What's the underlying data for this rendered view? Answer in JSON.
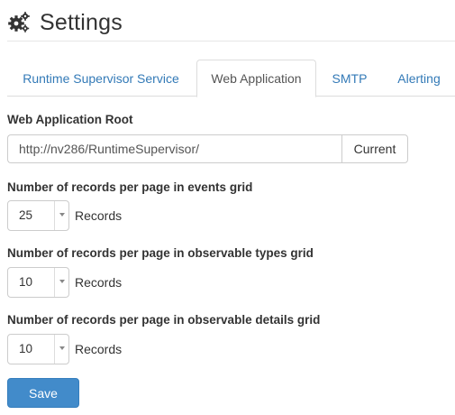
{
  "header": {
    "title": "Settings",
    "icon": "gears-icon"
  },
  "tabs": [
    {
      "label": "Runtime Supervisor Service",
      "active": false
    },
    {
      "label": "Web Application",
      "active": true
    },
    {
      "label": "SMTP",
      "active": false
    },
    {
      "label": "Alerting",
      "active": false
    }
  ],
  "web_app_root": {
    "label": "Web Application Root",
    "value": "http://nv286/RuntimeSupervisor/",
    "button_label": "Current"
  },
  "events_grid": {
    "label": "Number of records per page in events grid",
    "selected": "25",
    "suffix": "Records"
  },
  "observable_types_grid": {
    "label": "Number of records per page in observable types grid",
    "selected": "10",
    "suffix": "Records"
  },
  "observable_details_grid": {
    "label": "Number of records per page in observable details grid",
    "selected": "10",
    "suffix": "Records"
  },
  "save_label": "Save",
  "colors": {
    "link": "#337ab7",
    "primary": "#428bca",
    "border": "#cccccc"
  }
}
